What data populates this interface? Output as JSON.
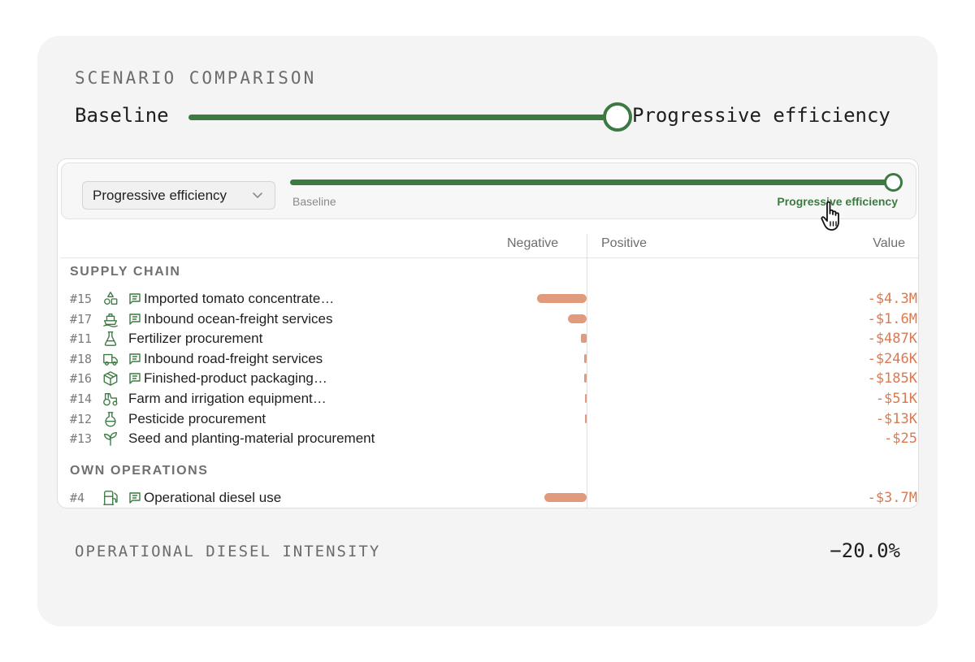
{
  "scenario": {
    "title": "SCENARIO COMPARISON",
    "left_label": "Baseline",
    "right_label": "Progressive efficiency",
    "position_fraction": 1.0
  },
  "toolbar": {
    "selected": "Progressive efficiency",
    "slider_left": "Baseline",
    "slider_right": "Progressive efficiency"
  },
  "columns": {
    "negative": "Negative",
    "positive": "Positive",
    "value": "Value"
  },
  "sections": [
    {
      "title": "SUPPLY CHAIN",
      "rows": [
        {
          "rank": "#15",
          "icon": "shapes-icon",
          "has_note": true,
          "label": "Imported tomato concentrate…",
          "value": "-$4.3M",
          "amount": -4300000
        },
        {
          "rank": "#17",
          "icon": "ship-icon",
          "has_note": true,
          "label": "Inbound ocean-freight services",
          "value": "-$1.6M",
          "amount": -1600000
        },
        {
          "rank": "#11",
          "icon": "flask-icon",
          "has_note": false,
          "label": "Fertilizer procurement",
          "value": "-$487K",
          "amount": -487000
        },
        {
          "rank": "#18",
          "icon": "truck-icon",
          "has_note": true,
          "label": "Inbound road-freight services",
          "value": "-$246K",
          "amount": -246000
        },
        {
          "rank": "#16",
          "icon": "package-icon",
          "has_note": true,
          "label": "Finished-product packaging…",
          "value": "-$185K",
          "amount": -185000
        },
        {
          "rank": "#14",
          "icon": "tractor-icon",
          "has_note": false,
          "label": "Farm and irrigation equipment…",
          "value": "-$51K",
          "amount": -51000
        },
        {
          "rank": "#12",
          "icon": "flask-round-icon",
          "has_note": false,
          "label": "Pesticide procurement",
          "value": "-$13K",
          "amount": -13000
        },
        {
          "rank": "#13",
          "icon": "sprout-icon",
          "has_note": false,
          "label": "Seed and planting-material procurement",
          "value": "-$25",
          "amount": -25
        }
      ]
    },
    {
      "title": "OWN OPERATIONS",
      "rows": [
        {
          "rank": "#4",
          "icon": "fuel-icon",
          "has_note": true,
          "label": "Operational diesel use",
          "value": "-$3.7M",
          "amount": -3700000
        }
      ]
    }
  ],
  "intensity": {
    "label": "OPERATIONAL DIESEL INTENSITY",
    "value": "−20.0%"
  },
  "colors": {
    "accent": "#3c7a42",
    "negative": "#e29a7c",
    "negative_text": "#d97a52",
    "card": "#f4f4f4"
  }
}
